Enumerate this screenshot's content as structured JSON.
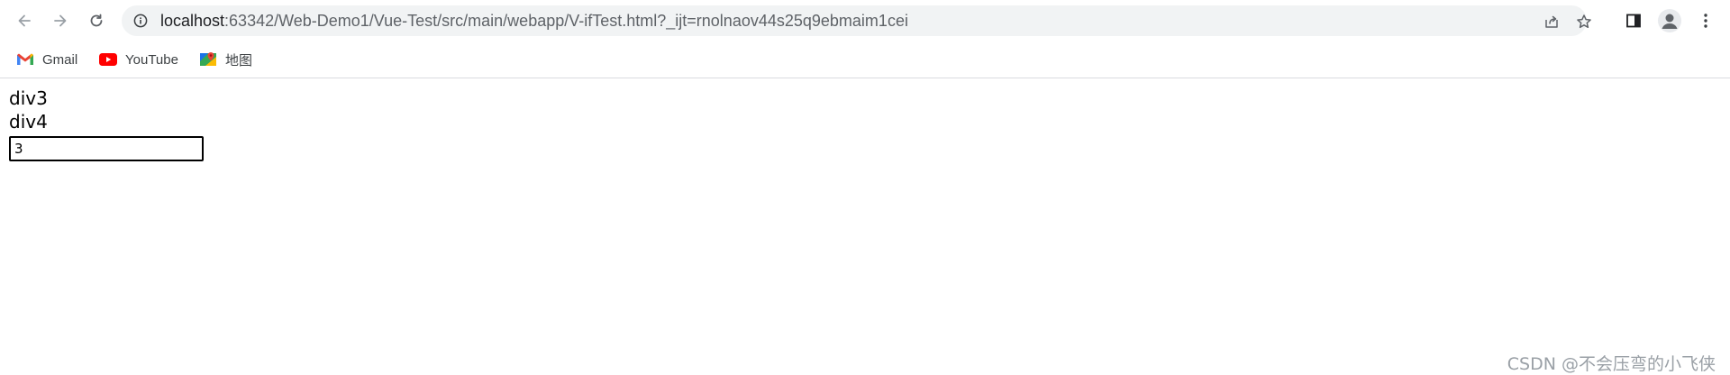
{
  "browser": {
    "url_host": "localhost",
    "url_path": ":63342/Web-Demo1/Vue-Test/src/main/webapp/V-ifTest.html?_ijt=rnolnaov44s25q9ebmaim1cei",
    "icons": {
      "back": "arrow-left-icon",
      "forward": "arrow-right-icon",
      "reload": "reload-icon",
      "site_info": "info-icon",
      "share": "share-icon",
      "bookmark_star": "star-icon",
      "side_panel": "side-panel-icon",
      "profile": "profile-icon",
      "menu": "kebab-menu-icon"
    }
  },
  "bookmarks": [
    {
      "label": "Gmail",
      "icon": "gmail-icon"
    },
    {
      "label": "YouTube",
      "icon": "youtube-icon"
    },
    {
      "label": "地图",
      "icon": "maps-icon"
    }
  ],
  "page": {
    "line1": "div3",
    "line2": "div4",
    "input_value": "3"
  },
  "watermark": "CSDN @不会压弯的小飞侠",
  "colors": {
    "omnibox_bg": "#f1f3f4",
    "divider": "#dadce0",
    "watermark": "#9aa0a6"
  }
}
